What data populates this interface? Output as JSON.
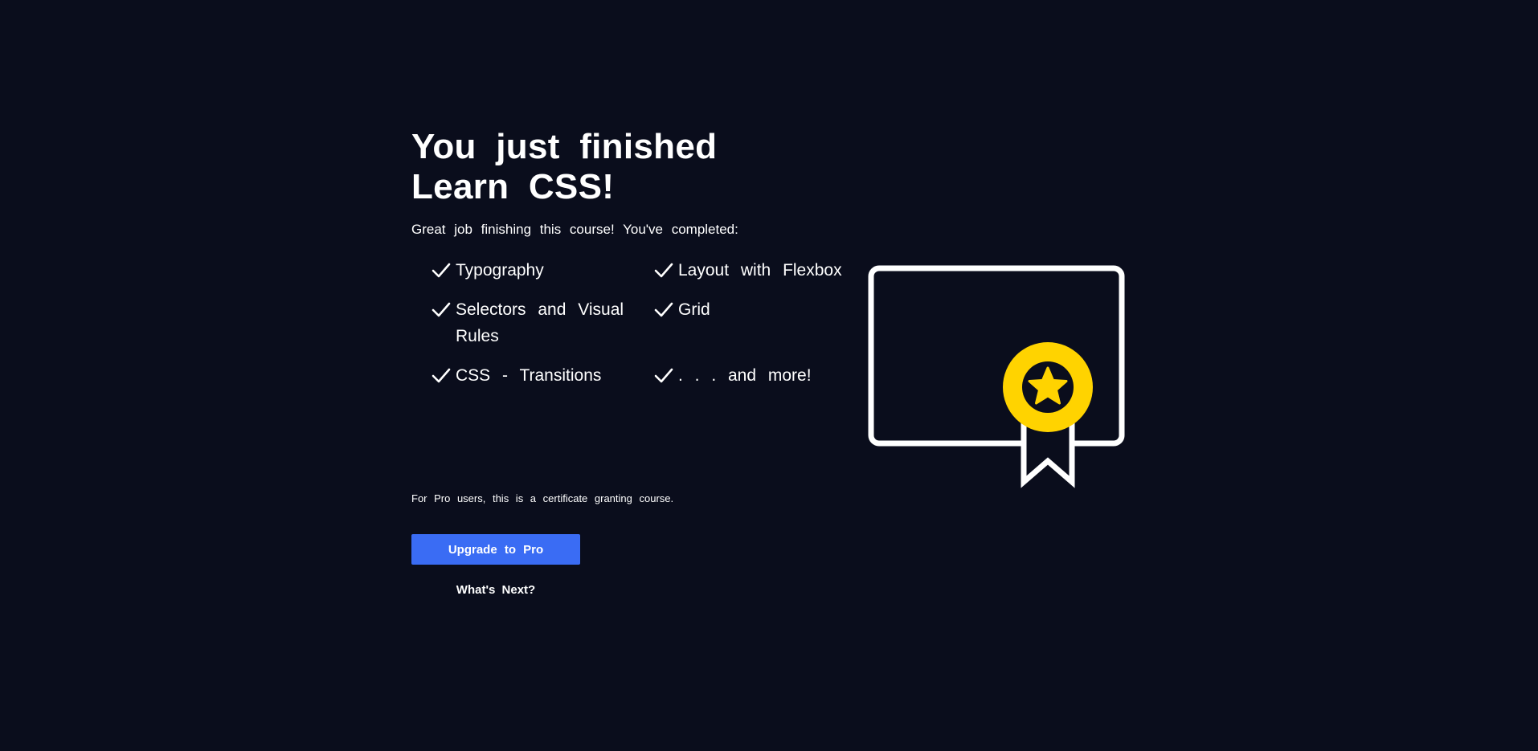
{
  "completion": {
    "heading_line1": "You just finished",
    "heading_line2": "Learn CSS!",
    "subtitle": "Great job finishing this course! You've completed:",
    "topics": [
      "Typography",
      "Layout with Flexbox",
      "Selectors and Visual Rules",
      "Grid",
      "CSS - Transitions",
      ". . . and more!"
    ],
    "pro_note": "For Pro users, this is a certificate granting course.",
    "upgrade_label": "Upgrade to Pro",
    "next_label": "What's Next?"
  },
  "icons": {
    "check": "checkmark-icon",
    "certificate": "certificate-icon",
    "ribbon": "ribbon-icon",
    "star": "star-icon"
  },
  "colors": {
    "background": "#0a0d1c",
    "text": "#ffffff",
    "accent_button": "#3a6cf4",
    "medal": "#ffd300"
  }
}
